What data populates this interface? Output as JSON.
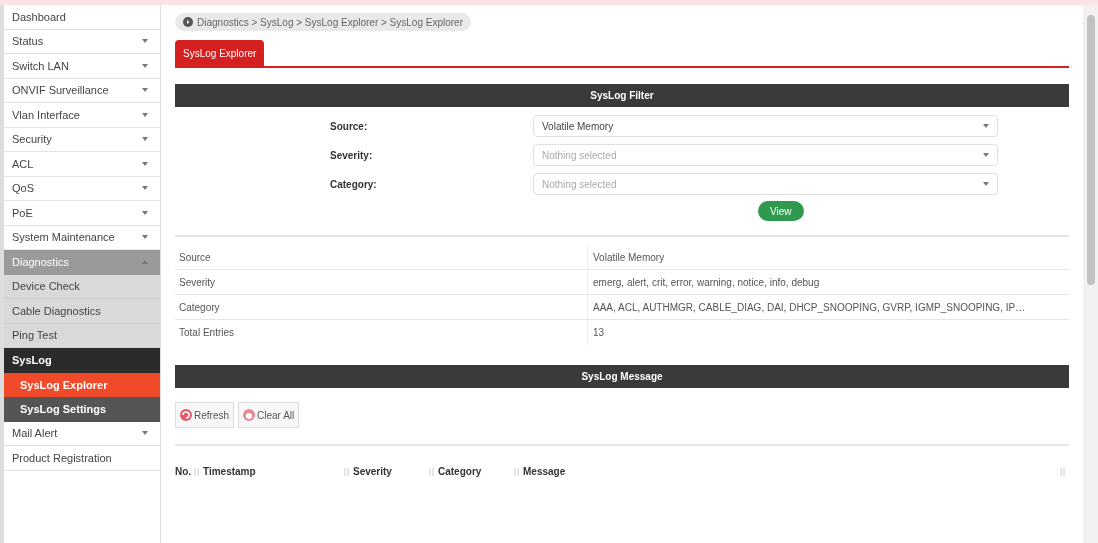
{
  "sidebar": {
    "items": [
      {
        "label": "Dashboard",
        "kind": "link",
        "selected": false
      },
      {
        "label": "Status",
        "kind": "group",
        "expanded": false
      },
      {
        "label": "Switch LAN",
        "kind": "group",
        "expanded": false
      },
      {
        "label": "ONVIF Surveillance",
        "kind": "group",
        "expanded": false
      },
      {
        "label": "Vlan Interface",
        "kind": "group",
        "expanded": false
      },
      {
        "label": "Security",
        "kind": "group",
        "expanded": false
      },
      {
        "label": "ACL",
        "kind": "group",
        "expanded": false
      },
      {
        "label": "QoS",
        "kind": "group",
        "expanded": false
      },
      {
        "label": "PoE",
        "kind": "group",
        "expanded": false
      },
      {
        "label": "System Maintenance",
        "kind": "group",
        "expanded": false
      },
      {
        "label": "Diagnostics",
        "kind": "group",
        "expanded": true,
        "children": [
          {
            "label": "Device Check",
            "kind": "link",
            "selected": false
          },
          {
            "label": "Cable Diagnostics",
            "kind": "link",
            "selected": false
          },
          {
            "label": "Ping Test",
            "kind": "link",
            "selected": false
          },
          {
            "label": "SysLog",
            "kind": "group",
            "expanded": true,
            "children": [
              {
                "label": "SysLog Explorer",
                "kind": "link",
                "selected": true
              },
              {
                "label": "SysLog Settings",
                "kind": "link",
                "selected": false
              }
            ]
          }
        ]
      },
      {
        "label": "Mail Alert",
        "kind": "group",
        "expanded": false
      },
      {
        "label": "Product Registration",
        "kind": "link",
        "selected": false
      }
    ]
  },
  "breadcrumb": "Diagnostics > SysLog > SysLog Explorer > SysLog Explorer",
  "tabs": [
    {
      "label": "SysLog Explorer",
      "selected": true
    }
  ],
  "filter": {
    "title": "SysLog Filter",
    "fields": [
      {
        "label": "Source:",
        "value": "Volatile Memory"
      },
      {
        "label": "Severity:",
        "placeholder": "Nothing selected"
      },
      {
        "label": "Category:",
        "placeholder": "Nothing selected"
      }
    ],
    "button": "View"
  },
  "summary": [
    {
      "label": "Source",
      "value": "Volatile Memory"
    },
    {
      "label": "Severity",
      "value": "emerg, alert, crit, error, warning, notice, info, debug"
    },
    {
      "label": "Category",
      "value": "AAA, ACL, AUTHMGR, CABLE_DIAG, DAI, DHCP_SNOOPING, GVRP, IGMP_SNOOPING, IP…"
    },
    {
      "label": "Total Entries",
      "value": "13"
    }
  ],
  "messages": {
    "title": "SysLog Message",
    "buttons": [
      {
        "label": "Refresh",
        "kind": "refresh"
      },
      {
        "label": "Clear All",
        "kind": "clear"
      }
    ],
    "table": {
      "columns": [
        "No.",
        "Timestamp",
        "Severity",
        "Category",
        "Message"
      ]
    }
  }
}
